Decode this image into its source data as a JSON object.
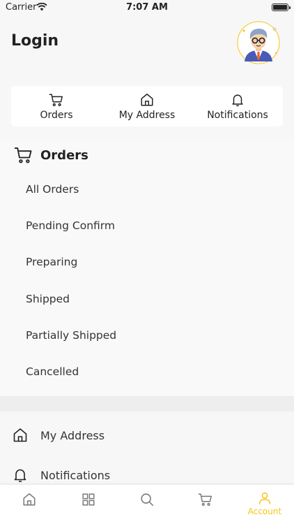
{
  "status_bar": {
    "carrier": "Carrier",
    "time": "7:07 AM"
  },
  "header": {
    "title": "Login"
  },
  "quick_actions": [
    {
      "label": "Orders",
      "icon": "cart-icon"
    },
    {
      "label": "My Address",
      "icon": "home-icon"
    },
    {
      "label": "Notifications",
      "icon": "bell-icon"
    }
  ],
  "orders": {
    "title": "Orders",
    "items": [
      "All Orders",
      "Pending Confirm",
      "Preparing",
      "Shipped",
      "Partially Shipped",
      "Cancelled"
    ]
  },
  "menu": {
    "items": [
      {
        "label": "My Address",
        "icon": "home-icon"
      },
      {
        "label": "Notifications",
        "icon": "bell-icon"
      }
    ]
  },
  "tab_bar": {
    "tabs": [
      {
        "icon": "home-icon",
        "label": ""
      },
      {
        "icon": "grid-icon",
        "label": ""
      },
      {
        "icon": "search-icon",
        "label": ""
      },
      {
        "icon": "cart-icon",
        "label": ""
      },
      {
        "icon": "user-icon",
        "label": "Account"
      }
    ],
    "accent_color": "#f5c518"
  }
}
